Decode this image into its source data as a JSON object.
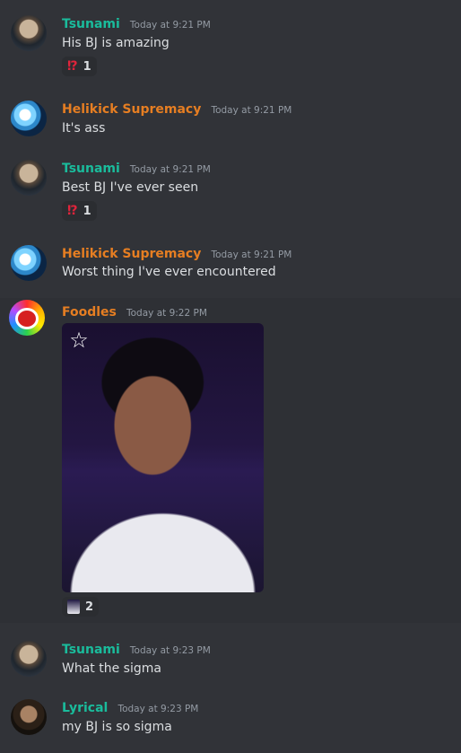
{
  "colors": {
    "background": "#313338",
    "tsunami": "#1abc9c",
    "helikick": "#e67e22",
    "foodles": "#e67e22",
    "lyrical": "#1abc9c"
  },
  "messages": [
    {
      "author": "Tsunami",
      "time": "Today at 9:21 PM",
      "text": "His BJ is amazing",
      "reaction": {
        "emoji": "⁉",
        "count": "1"
      }
    },
    {
      "author": "Helikick Supremacy",
      "time": "Today at 9:21 PM",
      "text": "It's ass"
    },
    {
      "author": "Tsunami",
      "time": "Today at 9:21 PM",
      "text": "Best BJ I've ever seen",
      "reaction": {
        "emoji": "⁉",
        "count": "1"
      }
    },
    {
      "author": "Helikick Supremacy",
      "time": "Today at 9:21 PM",
      "text": "Worst thing I've ever encountered"
    },
    {
      "author": "Foodles",
      "time": "Today at 9:22 PM",
      "attachment_icon": "star-icon",
      "reaction": {
        "emoji": "image-thumbnail",
        "count": "2"
      }
    },
    {
      "author": "Tsunami",
      "time": "Today at 9:23 PM",
      "text": "What the sigma"
    },
    {
      "author": "Lyrical",
      "time": "Today at 9:23 PM",
      "text": "my BJ is so sigma"
    }
  ]
}
